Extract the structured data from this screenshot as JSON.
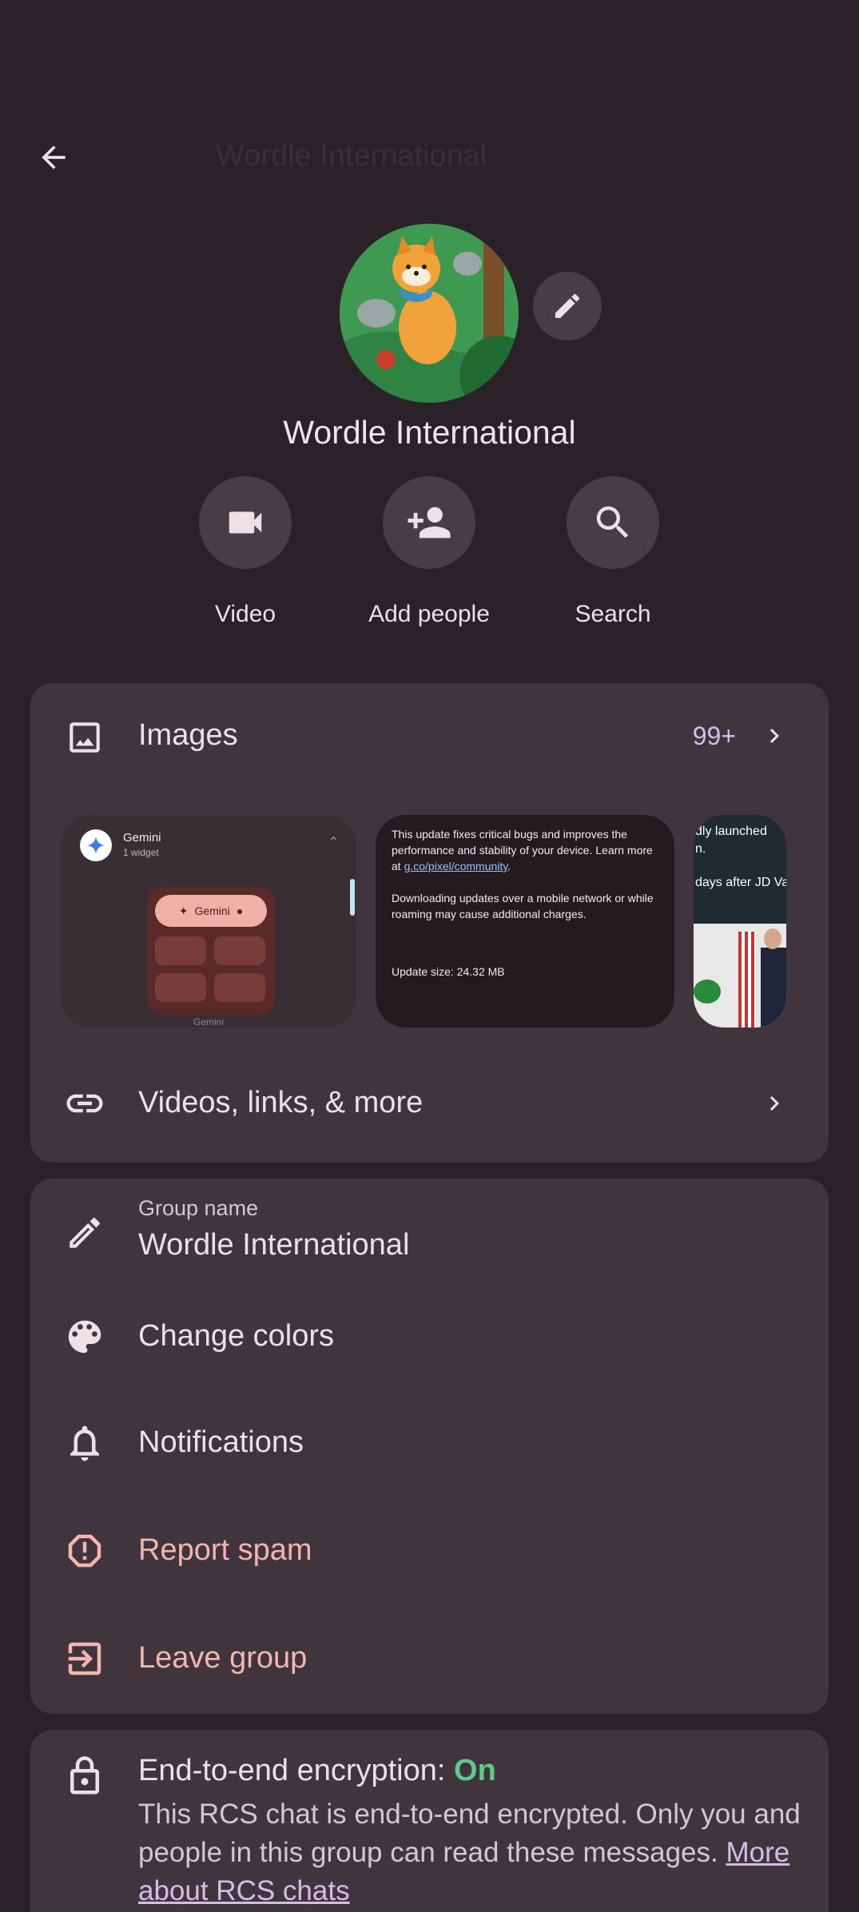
{
  "header": {
    "back_icon": "arrow-left-icon",
    "title": "Wordle International"
  },
  "profile": {
    "name": "Wordle International",
    "edit_icon": "pencil-icon"
  },
  "actions": [
    {
      "label": "Video",
      "icon": "videocam-icon"
    },
    {
      "label": "Add people",
      "icon": "person-add-icon"
    },
    {
      "label": "Search",
      "icon": "search-icon"
    }
  ],
  "media": {
    "images_label": "Images",
    "images_count": "99+",
    "more_label": "Videos, links, & more",
    "thumb1": {
      "app_name": "Gemini",
      "widget_count": "1 widget",
      "pill_label": "Gemini",
      "caption": "Gemini"
    },
    "thumb2": {
      "line1": "This update fixes critical bugs and improves the",
      "line2": "performance and stability of your device. Learn more",
      "line3_prefix": "at ",
      "line3_link": "g.co/pixel/community",
      "line3_suffix": ".",
      "line4": "Downloading updates over a mobile network or while",
      "line5": "roaming may cause additional charges.",
      "size": "Update size: 24.32 MB"
    },
    "thumb3": {
      "line1": "dly launched",
      "line2": "n.",
      "line3": "days after JD Va"
    }
  },
  "settings": {
    "group_name_label": "Group name",
    "group_name_value": "Wordle International",
    "change_colors": "Change colors",
    "notifications": "Notifications",
    "report_spam": "Report spam",
    "leave_group": "Leave group"
  },
  "encryption": {
    "title": "End-to-end encryption: ",
    "status": "On",
    "description": "This RCS chat is end-to-end encrypted. Only you and people in this group can read these messages. ",
    "link": "More about RCS chats"
  },
  "colors": {
    "background": "#2b2129",
    "card": "#41353d",
    "accent_spam": "#f2b6ad",
    "accent_on": "#5ecb8a",
    "accent_link": "#d6bde8"
  }
}
